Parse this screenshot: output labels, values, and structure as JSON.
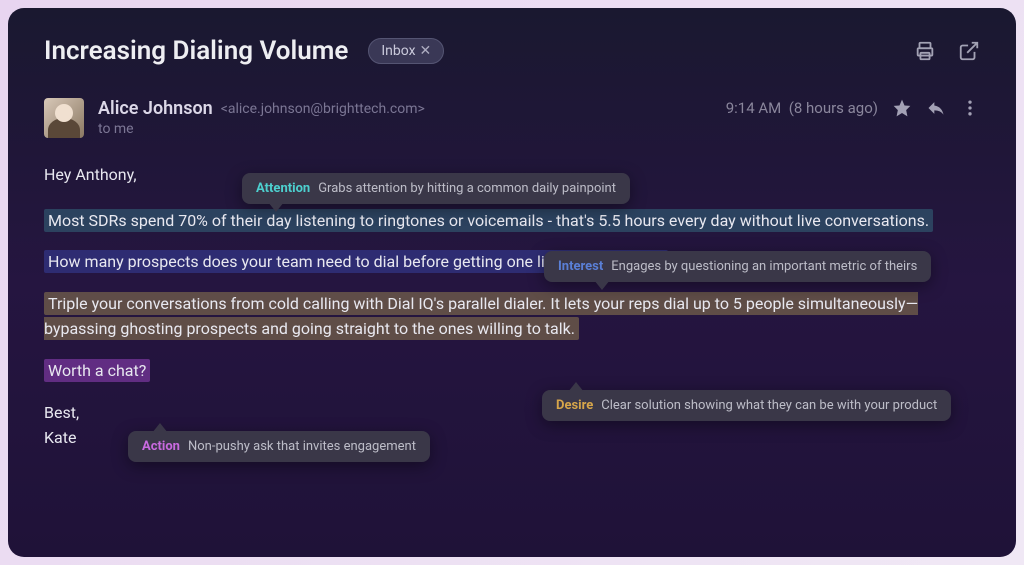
{
  "header": {
    "subject": "Increasing Dialing Volume",
    "label": "Inbox"
  },
  "sender": {
    "name": "Alice Johnson",
    "email": "<alice.johnson@brighttech.com>",
    "recipient": "to me",
    "time": "9:14 AM",
    "relative": "(8 hours ago)"
  },
  "body": {
    "greeting": "Hey Anthony,",
    "para_attention": "Most SDRs spend 70% of their day listening to ringtones or voicemails - that's 5.5 hours every day without live conversations.",
    "para_interest": "How many prospects does your team need to dial before getting one live conversation?",
    "para_desire": "Triple your conversations from cold calling with Dial IQ's parallel dialer. It lets your reps dial up to 5 people simultaneously—bypassing ghosting prospects and going straight to the ones willing to talk.",
    "para_action": "Worth a chat?",
    "signoff1": "Best,",
    "signoff2": "Kate"
  },
  "annotations": {
    "attention": {
      "tag": "Attention",
      "desc": "Grabs attention by hitting a common daily painpoint"
    },
    "interest": {
      "tag": "Interest",
      "desc": "Engages by questioning an important metric of theirs"
    },
    "desire": {
      "tag": "Desire",
      "desc": "Clear solution showing what they can be with your product"
    },
    "action": {
      "tag": "Action",
      "desc": "Non-pushy ask that invites engagement"
    }
  }
}
